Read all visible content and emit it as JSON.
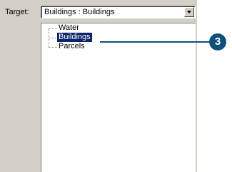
{
  "target": {
    "label": "Target:",
    "value": "Buildings : Buildings",
    "dropdown_icon": "chevron-down-icon"
  },
  "tree": {
    "items": [
      {
        "label": "Water",
        "selected": false
      },
      {
        "label": "Buildings",
        "selected": true
      },
      {
        "label": "Parcels",
        "selected": false
      }
    ]
  },
  "callout": {
    "number": "3",
    "color": "#0f4f7a"
  },
  "colors": {
    "panel_bg": "#d4d0c8",
    "selection_bg": "#0a246a"
  }
}
